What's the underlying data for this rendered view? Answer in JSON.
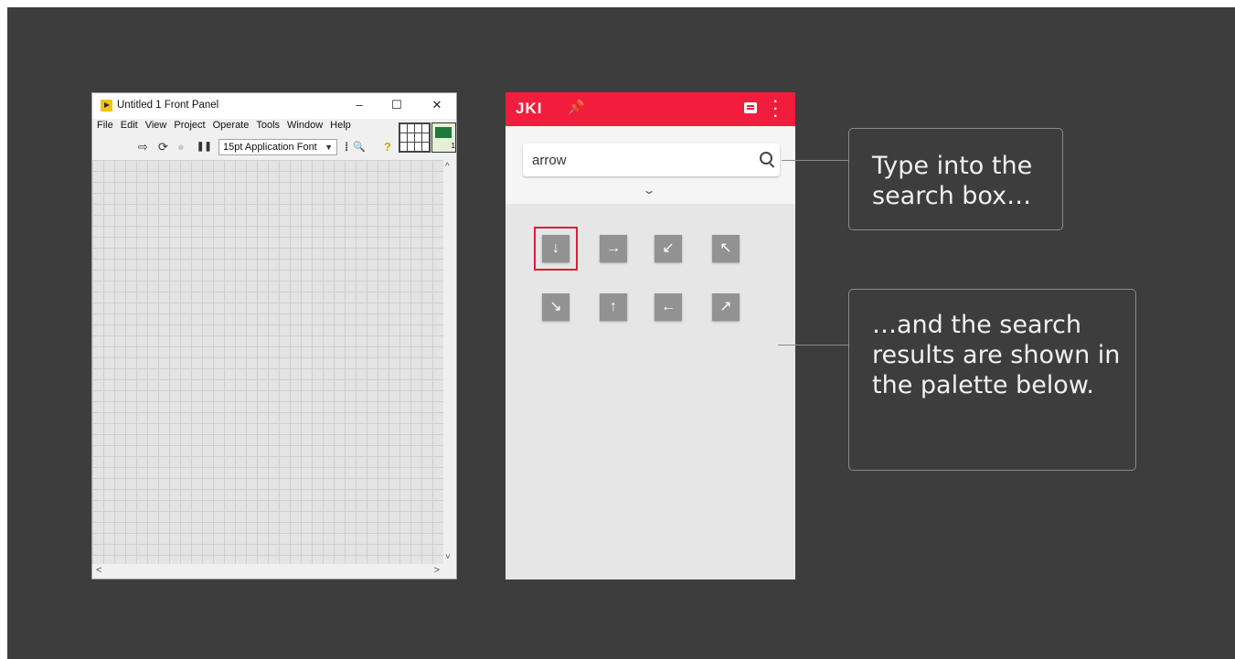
{
  "labview": {
    "title": "Untitled 1 Front Panel",
    "window_buttons": [
      "–",
      "☐",
      "✕"
    ],
    "menu": [
      "File",
      "Edit",
      "View",
      "Project",
      "Operate",
      "Tools",
      "Window",
      "Help"
    ],
    "toolbar": {
      "run_icon": "⇨",
      "run_continuous_icon": "⟳",
      "abort_icon": "●",
      "pause_icon": "❚❚",
      "font_dropdown": "15pt Application Font",
      "align_icon": "⁞",
      "search_icon": "🔍",
      "help_icon": "?"
    },
    "vi_icon_terminal": "1",
    "scroll": {
      "up": "^",
      "down": "˅",
      "left": "<",
      "right": ">"
    }
  },
  "palette": {
    "logo": "JKI",
    "pin_icon": "⬍",
    "search": {
      "value": "arrow"
    },
    "expand_icon": "⌄",
    "results": [
      "↓",
      "→",
      "↙",
      "↖",
      "↘",
      "↑",
      "←",
      "↗"
    ],
    "selected_index": 0,
    "accent": "#f01d3c"
  },
  "callouts": {
    "search": "Type into the search box…",
    "results": "…and the search results are shown in the palette below."
  }
}
